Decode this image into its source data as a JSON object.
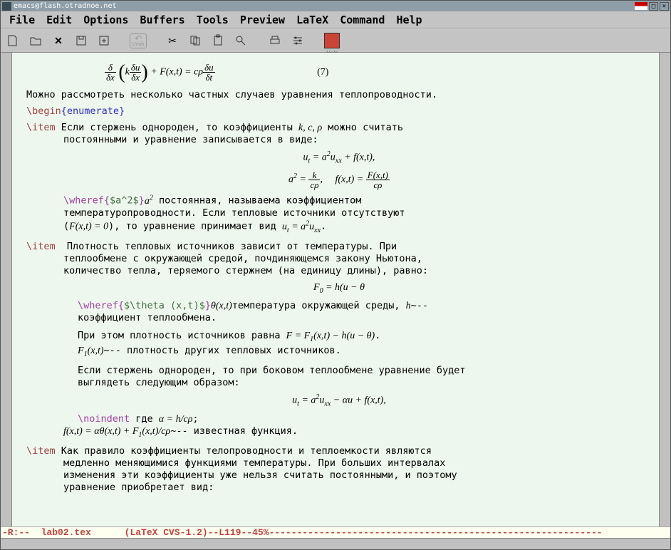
{
  "titlebar": {
    "title": "emacs@flash.otradnoe.net"
  },
  "menubar": {
    "items": [
      "File",
      "Edit",
      "Options",
      "Buffers",
      "Tools",
      "Preview",
      "LaTeX",
      "Command",
      "Help"
    ]
  },
  "toolbar": {
    "undo_label": "Undo",
    "help_label": "Help"
  },
  "modeline": {
    "left": "-R:-- ",
    "filename": "lab02.tex",
    "middle": "      (LaTeX CVS-1.2)--L119--45%",
    "dashes": "------------------------------------------------------------"
  },
  "content": {
    "eq7_num": "(7)",
    "intro": "Можно рассмотреть несколько частных случаев уравнения теплопроводности.",
    "begin_enum": "\\begin",
    "enum_env": "{enumerate}",
    "item_kw": "\\item",
    "item1_l1": " Если стержень однороден, то коэффициенты ",
    "item1_vars": "k, c, ρ",
    "item1_l1b": " можно считать",
    "item1_l2": "постоянными и уравнение записывается в виде:",
    "wheref_kw": "\\wheref{",
    "wheref_arg1": "$a^2$",
    "wheref_close": "}",
    "item1_text2a": " постоянная, называема коэффициентом",
    "item1_text2b": "температуропроводности. Если тепловые источники отсутствуют",
    "item1_text2c_a": "(",
    "item1_text2c_b": "), то уравнение принимает вид ",
    "item2_l1": " Плотность тепловых источников зависит от температуры. При",
    "item2_l2": "теплообмене с окружающей средой, почдиняющемся закону Ньютона,",
    "item2_l3": "количество тепла, теряемого стержнем (на единицу длины), равно:",
    "wheref_arg2": "$\\theta (x,t)$",
    "item2_text2a": "температура окружающей среды, ",
    "item2_text2b": "~--",
    "item2_text2c": "коэффициент теплообмена.",
    "item2_p3a": "При этом плотность источников равна ",
    "item2_p3b": ".",
    "item2_p3c": "~-- плотность других тепловых источников.",
    "item2_p4a": "Если стержень однороден, то при боковом теплообмене уравнение будет",
    "item2_p4b": "выглядеть следующим образом:",
    "noindent_kw": "\\noindent",
    "noindent_txt": " где ",
    "noindent_eq1": "α = h/cρ",
    "noindent_semi": ";",
    "noindent_line2": "~-- известная функция.",
    "item3_l1": " Как правило коэффициенты телопроводности и теплоемкости являются",
    "item3_l2": "медленно меняющимися функциями температуры. При больших интервалах",
    "item3_l3": "изменения эти коэффициенты уже нельзя считать постоянными, и поэтому",
    "item3_l4": "уравнение приобретает вид:"
  }
}
